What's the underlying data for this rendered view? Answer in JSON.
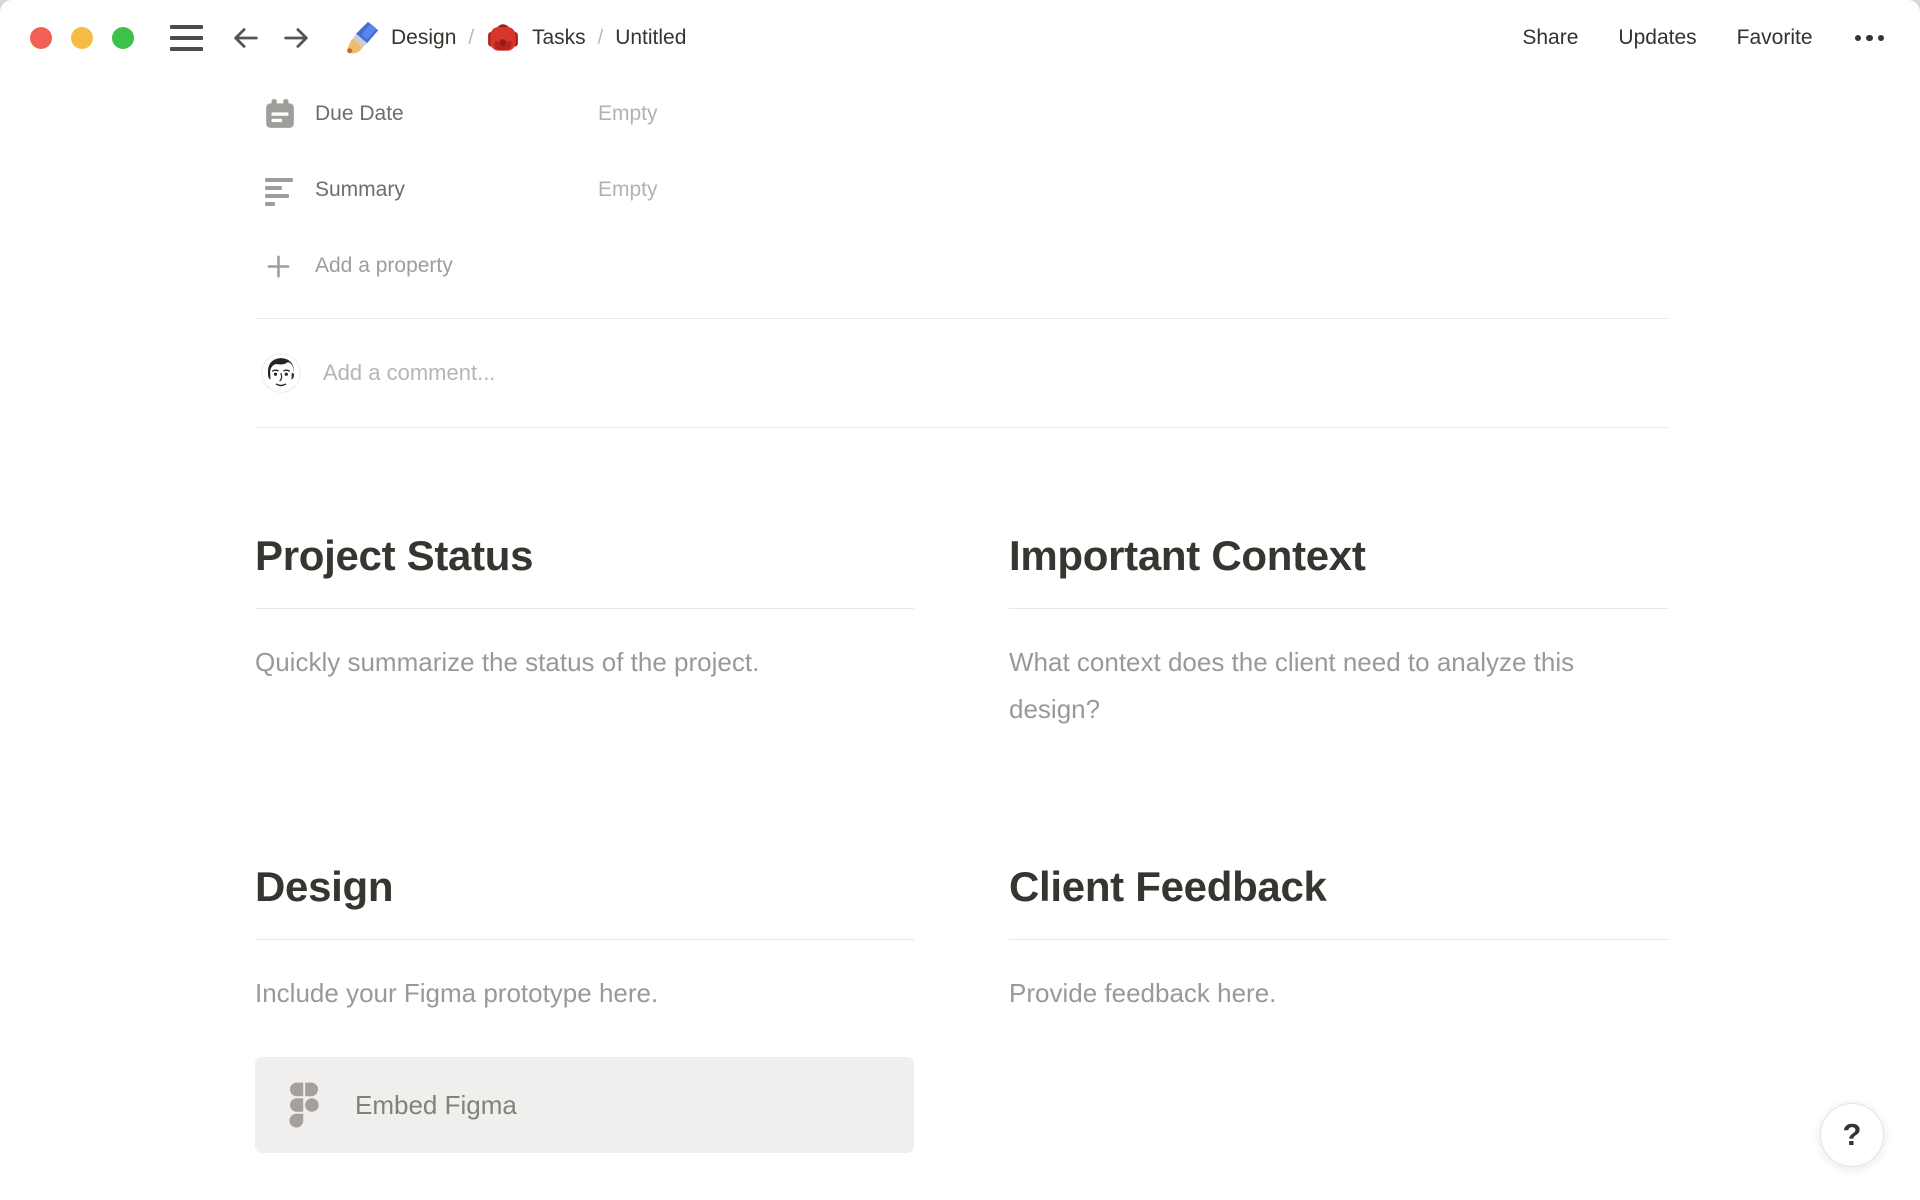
{
  "topbar": {
    "breadcrumb": {
      "separator": "/",
      "items": [
        {
          "icon": "paintbrush",
          "label": "Design"
        },
        {
          "icon": "backpack",
          "label": "Tasks"
        },
        {
          "label": "Untitled"
        }
      ]
    },
    "actions": {
      "share": "Share",
      "updates": "Updates",
      "favorite": "Favorite"
    }
  },
  "properties": {
    "rows": [
      {
        "icon": "calendar",
        "label": "Due Date",
        "value": "Empty"
      },
      {
        "icon": "text-lines",
        "label": "Summary",
        "value": "Empty"
      }
    ],
    "add_property": "Add a property"
  },
  "comment": {
    "placeholder": "Add a comment..."
  },
  "sections": [
    {
      "title": "Project Status",
      "body": "Quickly summarize the status of the project."
    },
    {
      "title": "Important Context",
      "body": "What context does the client need to analyze this design?"
    },
    {
      "title": "Design",
      "body": "Include your Figma prototype here.",
      "embed_button": "Embed Figma"
    },
    {
      "title": "Client Feedback",
      "body": "Provide feedback here."
    }
  ],
  "help": {
    "label": "?"
  },
  "colors": {
    "traffic_red": "#f15f57",
    "traffic_yellow": "#f5bd42",
    "traffic_green": "#3ac24a",
    "text_dark": "#37352f",
    "text_muted": "#9b9995",
    "embed_button_bg": "#f0efed"
  }
}
